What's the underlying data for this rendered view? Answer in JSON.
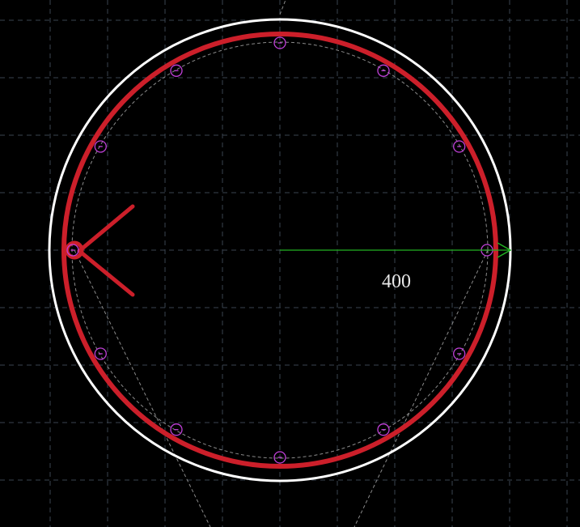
{
  "drawing": {
    "background_color": "#000000",
    "grid_color": "#3a4450",
    "outer_circle_color": "#ffffff",
    "rebar_ring_color": "#cc1f2a",
    "stirrup_hook_color": "#cc1f2a",
    "bar_marker_color": "#c040d8",
    "guide_line_color": "#8a8a8a",
    "dimension_color": "#22b322",
    "dimension_text_color": "#e8e8e8",
    "dimension": {
      "text": "400"
    },
    "bar_count": 12
  }
}
